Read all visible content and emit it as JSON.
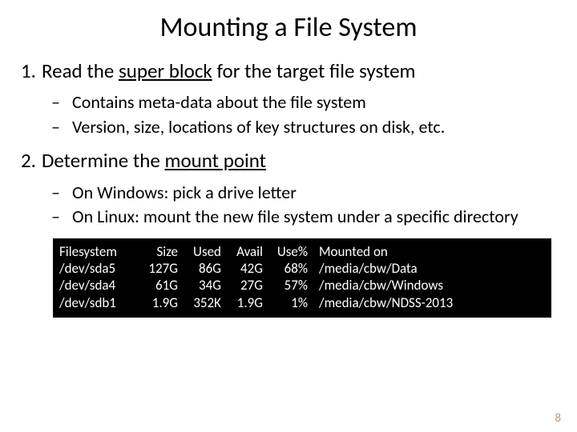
{
  "title": "Mounting a File System",
  "list": {
    "item1": {
      "num": "1.",
      "pre": "Read the ",
      "underlined": "super block",
      "post": " for the target file system",
      "sub": [
        "Contains meta-data about the file system",
        "Version, size, locations of key structures on disk, etc."
      ]
    },
    "item2": {
      "num": "2.",
      "pre": "Determine the ",
      "underlined": "mount point",
      "post": "",
      "sub": [
        "On Windows: pick a drive letter",
        "On Linux: mount the new file system under a specific directory"
      ]
    }
  },
  "terminal": {
    "header": [
      "Filesystem",
      "Size",
      "Used",
      "Avail",
      "Use%",
      "Mounted on"
    ],
    "rows": [
      [
        "/dev/sda5",
        "127G",
        "86G",
        "42G",
        "68%",
        "/media/cbw/Data"
      ],
      [
        "/dev/sda4",
        "61G",
        "34G",
        "27G",
        "57%",
        "/media/cbw/Windows"
      ],
      [
        "/dev/sdb1",
        "1.9G",
        "352K",
        "1.9G",
        "1%",
        "/media/cbw/NDSS-2013"
      ]
    ]
  },
  "pagenum": "8",
  "dash": "–"
}
